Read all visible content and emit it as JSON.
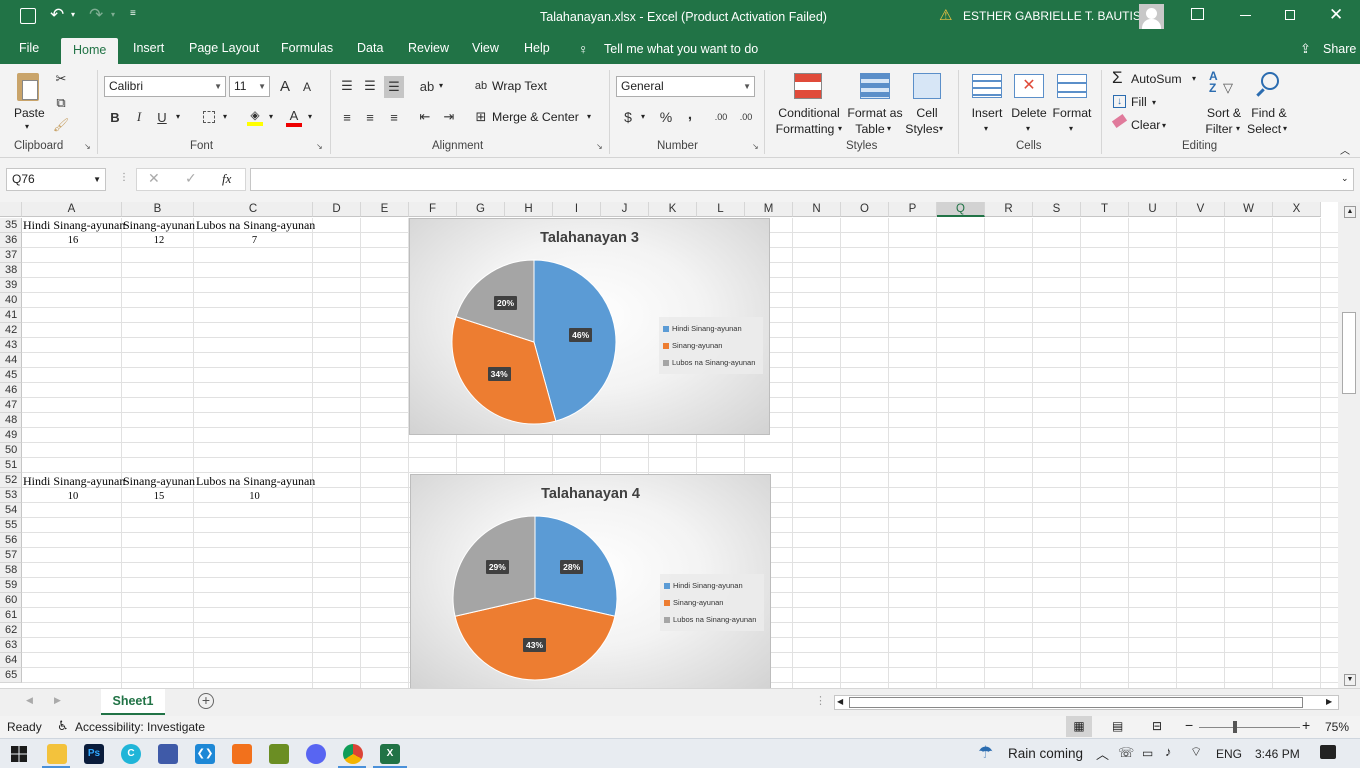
{
  "window": {
    "title": "Talahanayan.xlsx  -  Excel (Product Activation Failed)",
    "user": "ESTHER GABRIELLE T. BAUTISTA"
  },
  "tabs": [
    "File",
    "Home",
    "Insert",
    "Page Layout",
    "Formulas",
    "Data",
    "Review",
    "View",
    "Help"
  ],
  "tell_me": "Tell me what you want to do",
  "share": "Share",
  "ribbon": {
    "clipboard": {
      "label": "Clipboard",
      "paste": "Paste"
    },
    "font": {
      "label": "Font",
      "name": "Calibri",
      "size": "11",
      "bold": "B",
      "italic": "I",
      "underline": "U",
      "grow": "A",
      "shrink": "A"
    },
    "alignment": {
      "label": "Alignment",
      "wrap": "Wrap Text",
      "merge": "Merge & Center"
    },
    "number": {
      "label": "Number",
      "format": "General",
      "currency": "$",
      "percent": "%",
      "comma": ",",
      "inc_decimal": ".00",
      "dec_decimal": ".00"
    },
    "styles": {
      "label": "Styles",
      "conditional_1": "Conditional",
      "conditional_2": "Formatting",
      "format_table_1": "Format as",
      "format_table_2": "Table",
      "cell_styles_1": "Cell",
      "cell_styles_2": "Styles"
    },
    "cells": {
      "label": "Cells",
      "insert": "Insert",
      "delete": "Delete",
      "format": "Format"
    },
    "editing": {
      "label": "Editing",
      "autosum": "AutoSum",
      "fill": "Fill",
      "clear": "Clear",
      "sort_1": "Sort &",
      "sort_2": "Filter",
      "find_1": "Find &",
      "find_2": "Select"
    }
  },
  "formula_bar": {
    "name_box": "Q76",
    "fx": "fx",
    "value": ""
  },
  "columns": [
    "A",
    "B",
    "C",
    "D",
    "E",
    "F",
    "G",
    "H",
    "I",
    "J",
    "K",
    "L",
    "M",
    "N",
    "O",
    "P",
    "Q",
    "R",
    "S",
    "T",
    "U",
    "V",
    "W",
    "X"
  ],
  "rows": [
    "35",
    "36",
    "37",
    "38",
    "39",
    "40",
    "41",
    "42",
    "43",
    "44",
    "45",
    "46",
    "47",
    "48",
    "49",
    "50",
    "51",
    "52",
    "53",
    "54",
    "55",
    "56",
    "57",
    "58",
    "59",
    "60",
    "61",
    "62",
    "63",
    "64",
    "65"
  ],
  "cells": {
    "r35": [
      "Hindi Sinang-ayunan",
      "Sinang-ayunan",
      "Lubos na Sinang-ayunan"
    ],
    "r36": [
      "16",
      "12",
      "7"
    ],
    "r52": [
      "Hindi Sinang-ayunan",
      "Sinang-ayunan",
      "Lubos na Sinang-ayunan"
    ],
    "r53": [
      "10",
      "15",
      "10"
    ]
  },
  "colors": {
    "blue": "#5b9bd5",
    "orange": "#ed7d31",
    "gray": "#a5a5a5",
    "excel_green": "#217346"
  },
  "chart_data": [
    {
      "type": "pie",
      "title": "Talahanayan 3",
      "categories": [
        "Hindi Sinang-ayunan",
        "Sinang-ayunan",
        "Lubos na Sinang-ayunan"
      ],
      "values": [
        16,
        12,
        7
      ],
      "data_labels": [
        "46%",
        "34%",
        "20%"
      ],
      "legend": "right"
    },
    {
      "type": "pie",
      "title": "Talahanayan 4",
      "categories": [
        "Hindi Sinang-ayunan",
        "Sinang-ayunan",
        "Lubos na Sinang-ayunan"
      ],
      "values": [
        10,
        15,
        10
      ],
      "data_labels": [
        "28%",
        "43%",
        "29%"
      ],
      "legend": "right"
    }
  ],
  "sheet_tabs": [
    "Sheet1"
  ],
  "status": {
    "ready": "Ready",
    "accessibility": "Accessibility: Investigate",
    "zoom": "75%"
  },
  "taskbar": {
    "weather": "Rain coming",
    "lang": "ENG",
    "time": "3:46 PM"
  }
}
